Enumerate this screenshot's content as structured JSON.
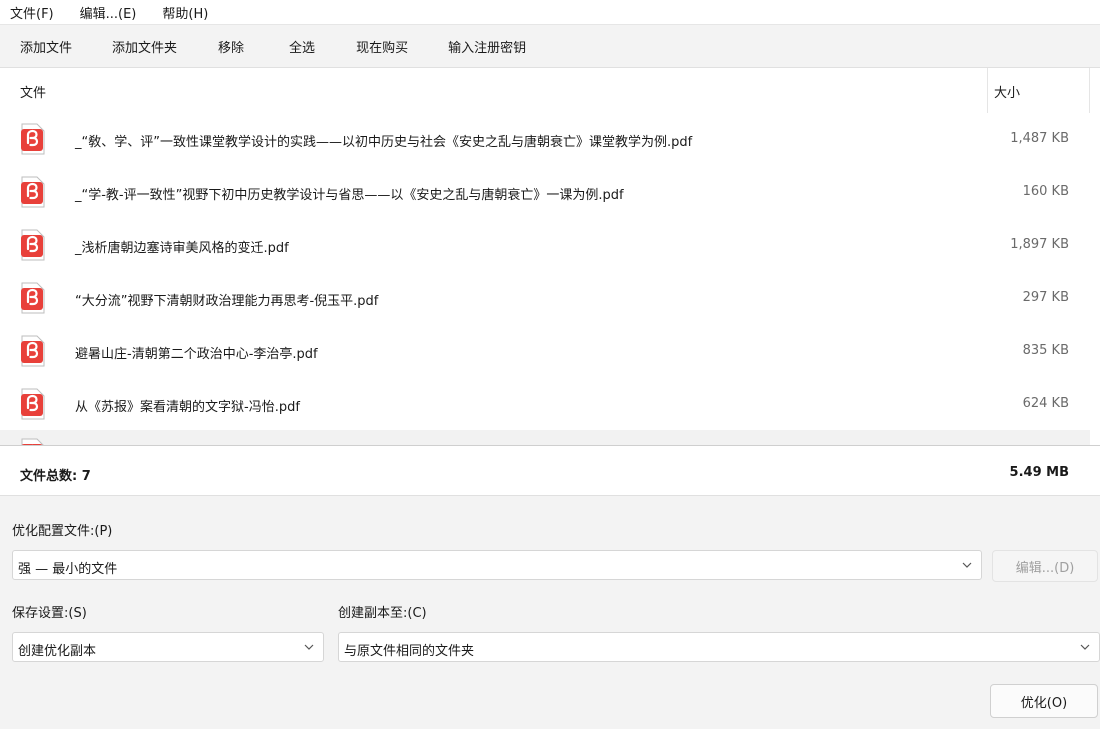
{
  "menubar": {
    "items": [
      "文件(F)",
      "编辑...(E)",
      "帮助(H)"
    ]
  },
  "toolbar": {
    "items": [
      "添加文件",
      "添加文件夹",
      "移除",
      "全选",
      "现在购买",
      "输入注册密钥"
    ]
  },
  "file_list": {
    "header_file": "文件",
    "header_size": "大小",
    "rows": [
      {
        "name": "_“敎、学、评”一致性课堂教学设计的实践——以初中历史与社会《安史之乱与唐朝衰亡》课堂教学为例.pdf",
        "size": "1,487 KB"
      },
      {
        "name": "_“学-教-评一致性”视野下初中历史教学设计与省思——以《安史之乱与唐朝衰亡》一课为例.pdf",
        "size": "160 KB"
      },
      {
        "name": "_浅析唐朝边塞诗审美风格的变迁.pdf",
        "size": "1,897 KB"
      },
      {
        "name": "“大分流”视野下清朝财政治理能力再思考-倪玉平.pdf",
        "size": "297 KB"
      },
      {
        "name": "避暑山庄-清朝第二个政治中心-李治亭.pdf",
        "size": "835 KB"
      },
      {
        "name": "从《苏报》案看清朝的文字狱-冯怡.pdf",
        "size": "624 KB"
      }
    ]
  },
  "summary": {
    "total_label": "文件总数: 7",
    "total_size": "5.49 MB"
  },
  "settings": {
    "profile_label": "优化配置文件:(P)",
    "profile_value": "强 — 最小的文件",
    "edit_button": "编辑...(D)",
    "save_label": "保存设置:(S)",
    "save_value": "创建优化副本",
    "copy_label": "创建副本至:(C)",
    "copy_value": "与原文件相同的文件夹",
    "optimize_button": "优化(O)"
  },
  "colors": {
    "pdf_red": "#e8403a",
    "window_bg": "#f3f3f3"
  }
}
